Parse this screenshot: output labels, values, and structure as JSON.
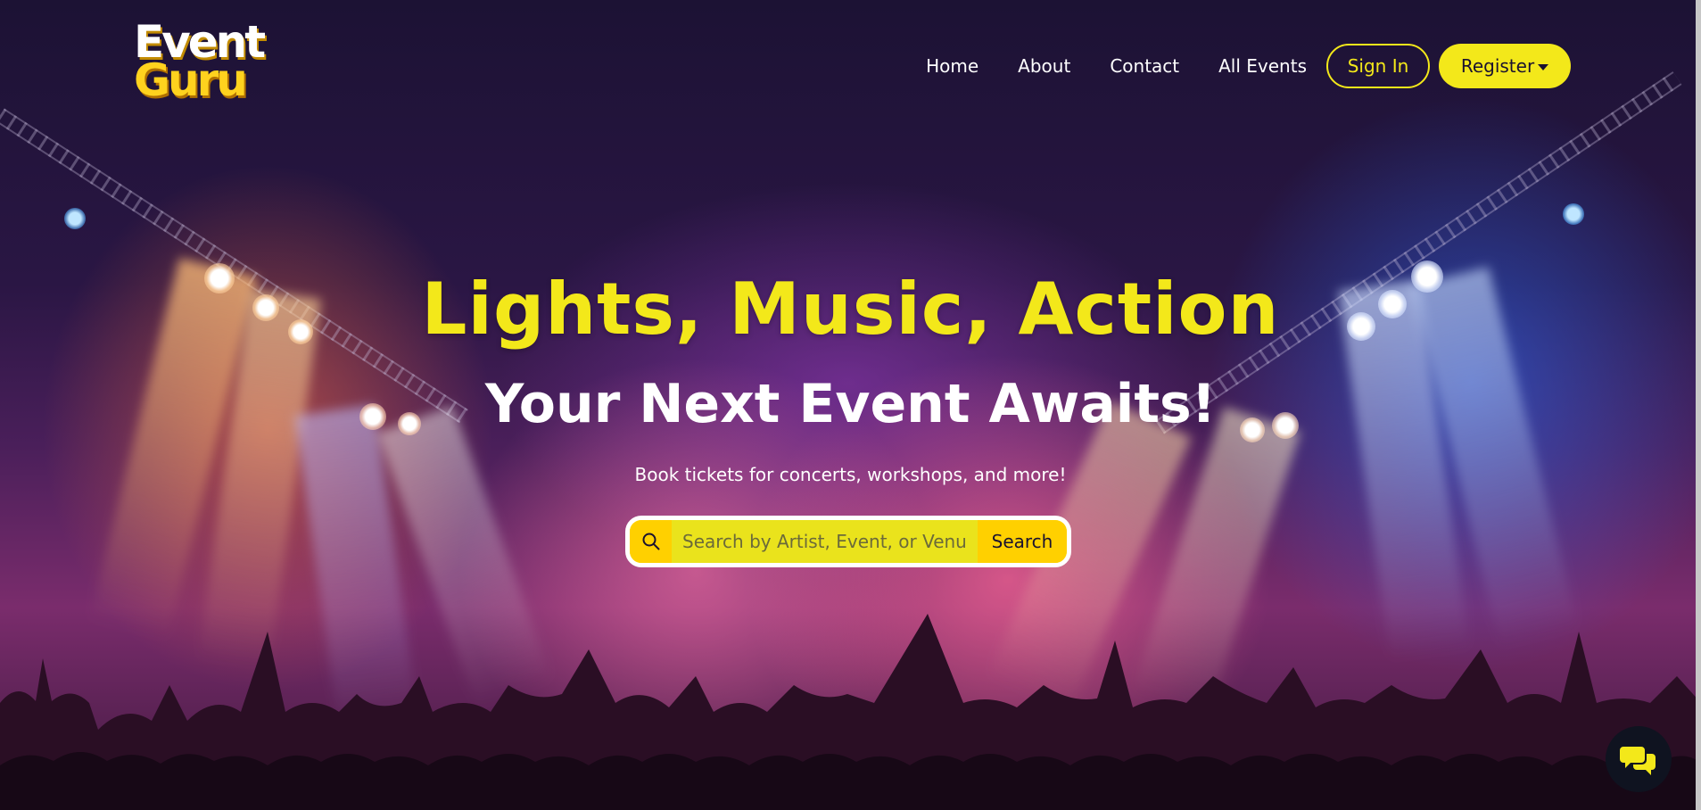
{
  "brand": {
    "line1": "Event",
    "line2": "Guru"
  },
  "nav": {
    "links": [
      "Home",
      "About",
      "Contact",
      "All Events"
    ],
    "sign_in": "Sign In",
    "register": "Register"
  },
  "hero": {
    "headline": "Lights, Music, Action",
    "subheadline": "Your Next Event Awaits!",
    "tagline": "Book tickets for concerts, workshops, and more!"
  },
  "search": {
    "placeholder": "Search by Artist, Event, or Venue",
    "button": "Search"
  },
  "icons": {
    "search": "search-icon",
    "chat": "chat-icon",
    "register_caret": "caret-down-icon"
  },
  "colors": {
    "accent": "#f3e81a",
    "search_bg": "#ffd000",
    "chat_bg": "#0f1320"
  }
}
